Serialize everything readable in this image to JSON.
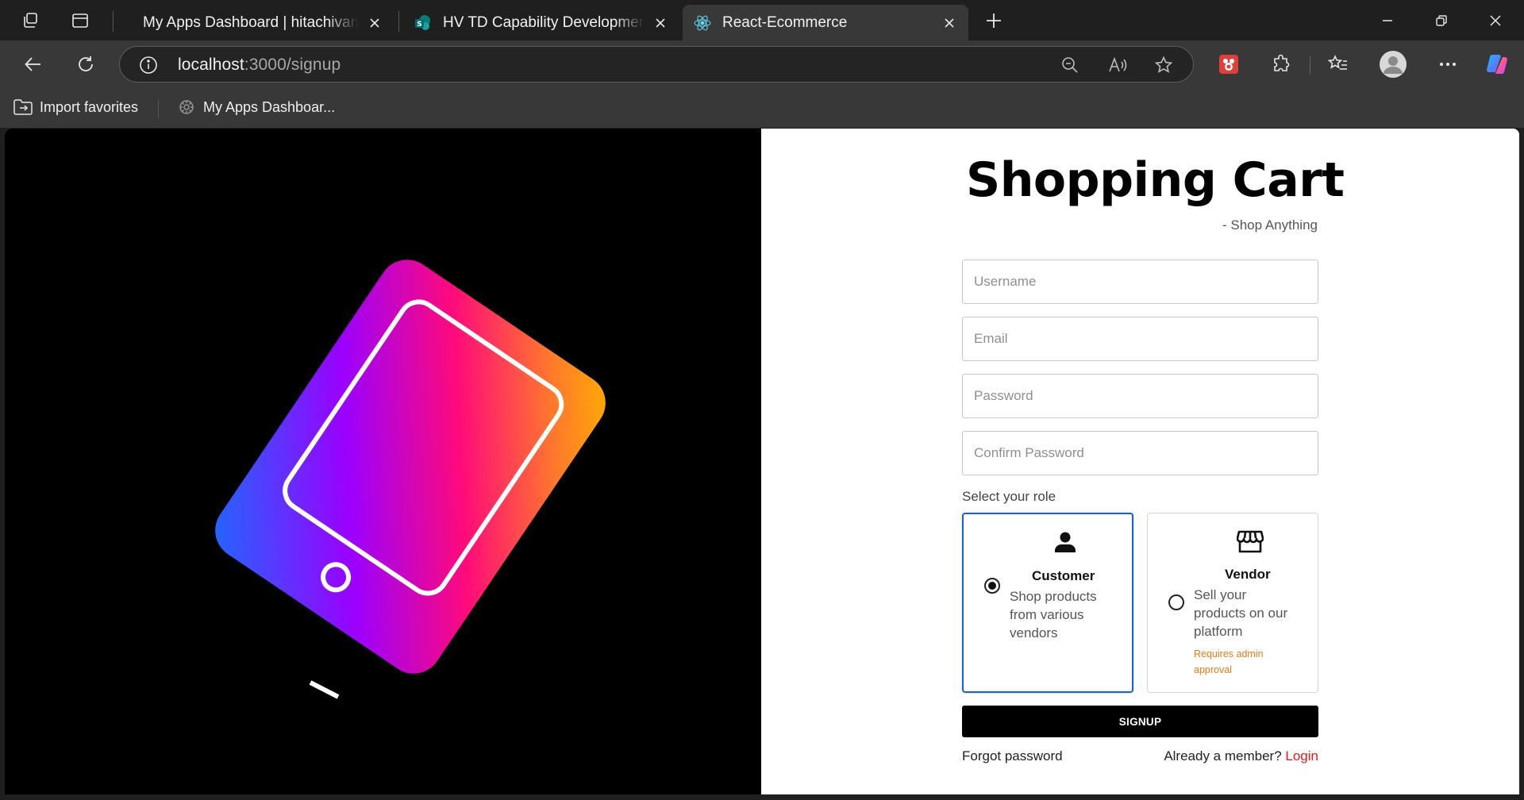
{
  "browser": {
    "tabs": [
      {
        "title": "My Apps Dashboard | hitachivantara",
        "active": false
      },
      {
        "title": "HV TD Capability Development (L",
        "active": false
      },
      {
        "title": "React-Ecommerce",
        "active": true
      }
    ],
    "address": {
      "host": "localhost",
      "path": ":3000/signup"
    },
    "favorites": [
      {
        "label": "Import favorites",
        "icon": "import-favorites-icon"
      },
      {
        "label": "My Apps Dashboar...",
        "icon": "apps-dashboard-icon"
      }
    ]
  },
  "page": {
    "brand_title": "Shopping Cart",
    "brand_subtitle": "- Shop Anything",
    "fields": {
      "username": {
        "placeholder": "Username",
        "value": ""
      },
      "email": {
        "placeholder": "Email",
        "value": ""
      },
      "password": {
        "placeholder": "Password",
        "value": ""
      },
      "confirm_password": {
        "placeholder": "Confirm Password",
        "value": ""
      }
    },
    "role_label": "Select your role",
    "roles": [
      {
        "name": "Customer",
        "description": "Shop products from various vendors",
        "note": "",
        "selected": true,
        "icon": "person-icon"
      },
      {
        "name": "Vendor",
        "description": "Sell your products on our platform",
        "note": "Requires admin approval",
        "selected": false,
        "icon": "storefront-icon"
      }
    ],
    "signup_label": "SIGNUP",
    "forgot_label": "Forgot password",
    "already_member": "Already a member?",
    "login_label": "Login"
  },
  "colors": {
    "selected_border": "#1e64c8",
    "link_red": "#e51a1a",
    "note_orange": "#ef7a12",
    "gradient_start": "#1a6cff",
    "gradient_mid": "#9b00ff",
    "gradient_hot": "#ff0a7a",
    "gradient_end": "#ffb000"
  }
}
